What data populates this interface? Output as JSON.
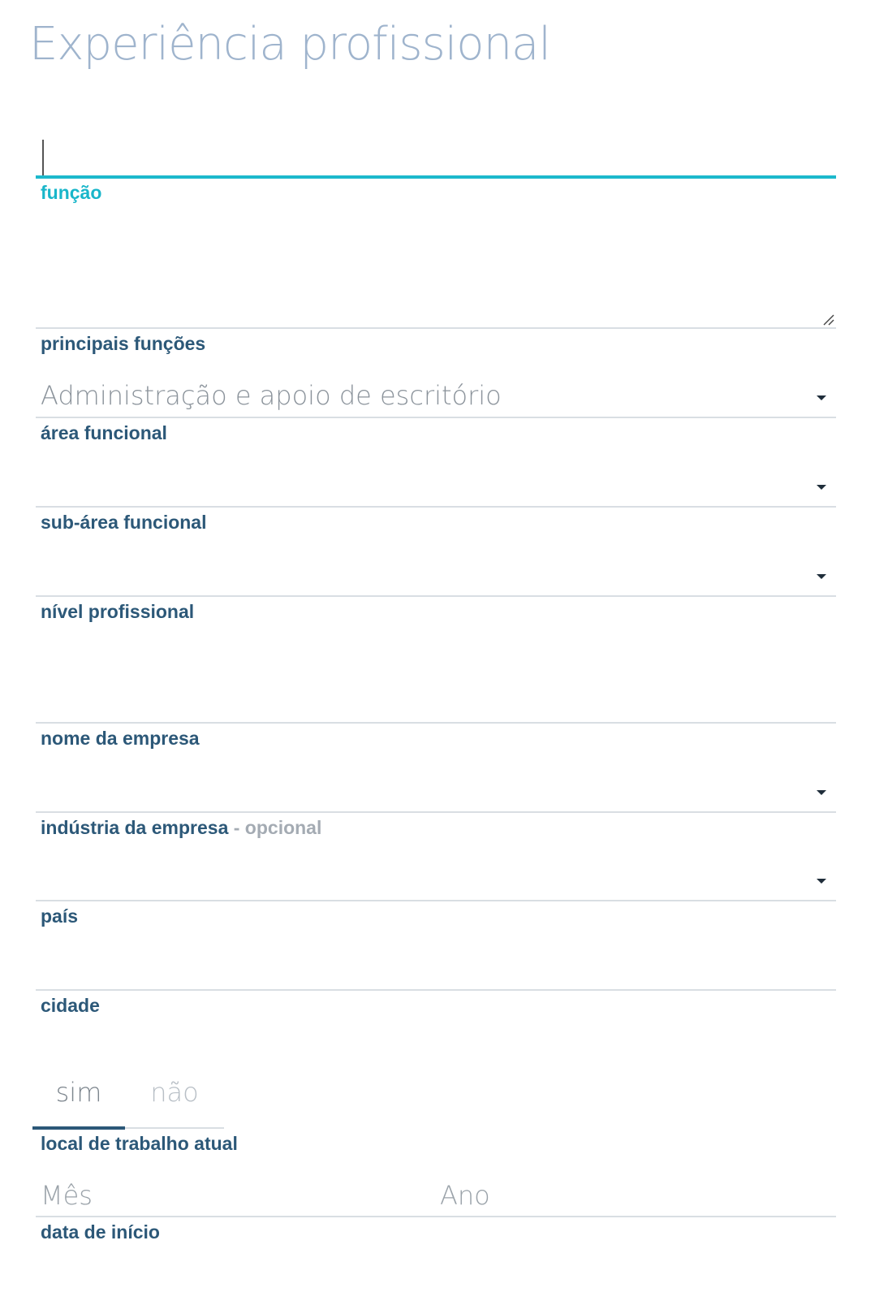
{
  "page": {
    "title": "Experiência profissional"
  },
  "fields": {
    "funcao": {
      "label": "função",
      "value": ""
    },
    "principais_funcoes": {
      "label": "principais funções",
      "value": ""
    },
    "area_funcional": {
      "label": "área funcional",
      "value": "Administração e apoio de escritório"
    },
    "sub_area_funcional": {
      "label": "sub-área funcional",
      "value": ""
    },
    "nivel_profissional": {
      "label": "nível profissional",
      "value": ""
    },
    "nome_empresa": {
      "label": "nome da empresa",
      "value": ""
    },
    "industria_empresa": {
      "label": "indústria da empresa",
      "optional_suffix": " - opcional",
      "value": ""
    },
    "pais": {
      "label": "país",
      "value": ""
    },
    "cidade": {
      "label": "cidade",
      "value": ""
    },
    "local_trabalho_atual": {
      "label": "local de trabalho atual",
      "option_yes": "sim",
      "option_no": "não",
      "selected": "sim"
    },
    "data_inicio": {
      "label": "data de início",
      "month_placeholder": "Mês",
      "year_placeholder": "Ano"
    }
  },
  "colors": {
    "title": "#9fb4cd",
    "label": "#2c5878",
    "active_accent": "#1db9cc",
    "optional_text": "#a4abb3",
    "divider": "#d9dee3"
  },
  "icons": {
    "dropdown": "caret-down-icon",
    "resize": "resize-handle-icon"
  }
}
